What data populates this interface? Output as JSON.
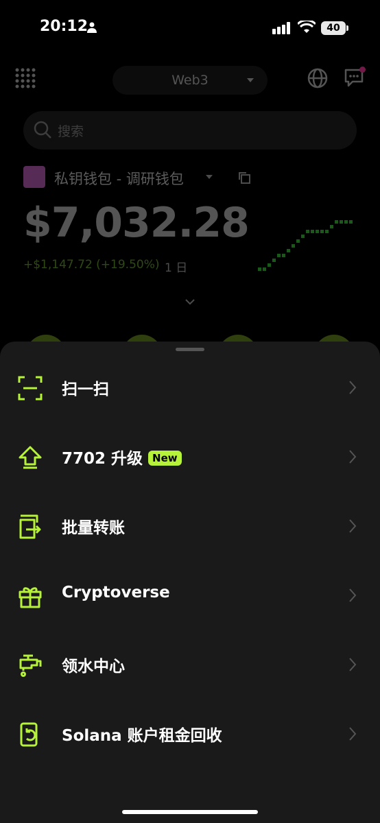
{
  "status_bar": {
    "time": "20:12",
    "battery": "40"
  },
  "header": {
    "network": "Web3"
  },
  "search": {
    "placeholder": "搜索"
  },
  "wallet": {
    "name": "私钥钱包 - 调研钱包",
    "balance": "$7,032.28",
    "change": "+$1,147.72 (+19.50%)",
    "period": "1 日"
  },
  "menu": {
    "items": [
      {
        "label": "扫一扫",
        "icon": "scan-icon"
      },
      {
        "label": "7702 升级",
        "badge": "New",
        "icon": "upgrade-icon"
      },
      {
        "label": "批量转账",
        "icon": "batch-transfer-icon"
      },
      {
        "label": "Cryptoverse",
        "icon": "gift-icon"
      },
      {
        "label": "领水中心",
        "icon": "faucet-icon"
      },
      {
        "label": "Solana 账户租金回收",
        "icon": "rent-reclaim-icon"
      }
    ]
  },
  "colors": {
    "accent": "#b6f23a",
    "sheet_bg": "#1a1a1a",
    "background": "#000000"
  }
}
